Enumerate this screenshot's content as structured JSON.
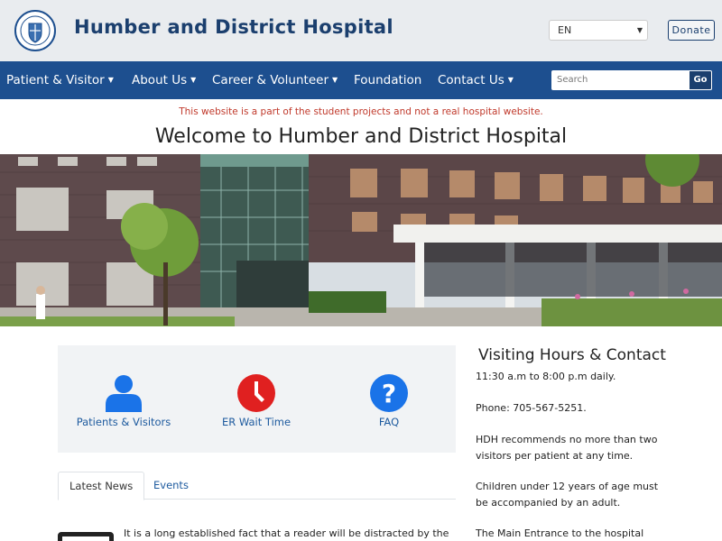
{
  "header": {
    "title": "Humber and District Hospital",
    "language": "EN",
    "donate_label": "Donate",
    "logo_icon": "hospital-crest-icon"
  },
  "nav": {
    "items": [
      {
        "label": "Patient & Visitor",
        "dropdown": true
      },
      {
        "label": "About Us",
        "dropdown": true
      },
      {
        "label": "Career & Volunteer",
        "dropdown": true
      },
      {
        "label": "Foundation",
        "dropdown": false
      },
      {
        "label": "Contact Us",
        "dropdown": true
      }
    ],
    "search_placeholder": "Search",
    "search_button": "Go"
  },
  "disclaimer": "This website is a part of the student projects and not a real hospital website.",
  "welcome": "Welcome to Humber and District Hospital",
  "quick_links": [
    {
      "label": "Patients & Visitors",
      "icon": "user-icon"
    },
    {
      "label": "ER Wait Time",
      "icon": "clock-icon"
    },
    {
      "label": "FAQ",
      "icon": "question-icon"
    }
  ],
  "tabs": [
    {
      "label": "Latest News",
      "active": true
    },
    {
      "label": "Events",
      "active": false
    }
  ],
  "news": {
    "first_text": "It is a long established fact that a reader will be distracted by the"
  },
  "sidebar": {
    "title": "Visiting Hours & Contact",
    "hours": "11:30 a.m to 8:00 p.m daily.",
    "phone": "Phone: 705-567-5251.",
    "visitors_l1": "HDH recommends no more than two",
    "visitors_l2": "visitors per patient at any time.",
    "children_l1": "Children under 12 years of age must",
    "children_l2": "be accompanied by an adult.",
    "entrance": "The Main Entrance to the hospital"
  },
  "colors": {
    "brand": "#1d4f8f",
    "disclaimer": "#c0392b",
    "icon_blue": "#1a73e8",
    "icon_red": "#e02020"
  }
}
